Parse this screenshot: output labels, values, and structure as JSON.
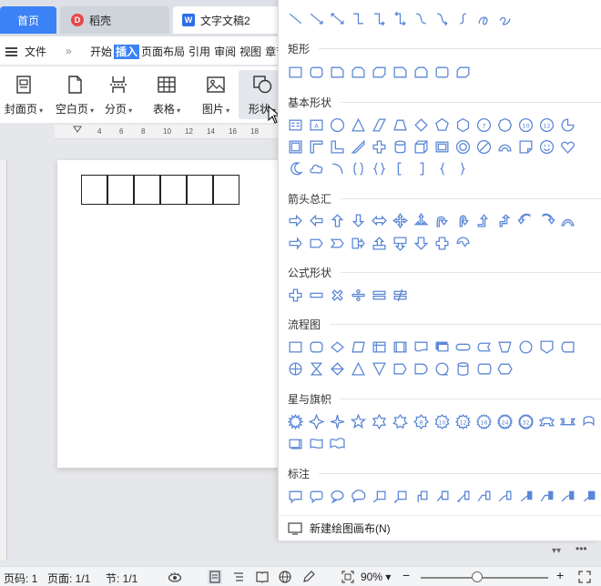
{
  "tabs": {
    "home": "首页",
    "daoke": "稻壳",
    "doc": "文字文稿2"
  },
  "menu": {
    "file": "文件",
    "more": "»",
    "items": [
      "开始",
      "插入",
      "页面布局",
      "引用",
      "审阅",
      "视图",
      "章节"
    ],
    "active_index": 1
  },
  "ribbon": {
    "cover": "封面页",
    "blank": "空白页",
    "pagebreak": "分页",
    "table": "表格",
    "picture": "图片",
    "shape": "形状"
  },
  "ruler": {
    "ticks": [
      "4",
      "6",
      "8",
      "10",
      "12",
      "14",
      "16",
      "18"
    ]
  },
  "shapes_panel": {
    "sections": {
      "rect": "矩形",
      "basic": "基本形状",
      "arrows": "箭头总汇",
      "formula": "公式形状",
      "flow": "流程图",
      "stars": "星与旗帜",
      "callouts": "标注"
    },
    "footer": "新建绘图画布(N)"
  },
  "statusbar": {
    "page_num": "页码: 1",
    "pages": "页面: 1/1",
    "section": "节: 1/1",
    "zoom": "90%",
    "zoom_level_percent": 90
  },
  "colors": {
    "accent": "#3b82f6",
    "shape_stroke": "#5b87d6"
  }
}
